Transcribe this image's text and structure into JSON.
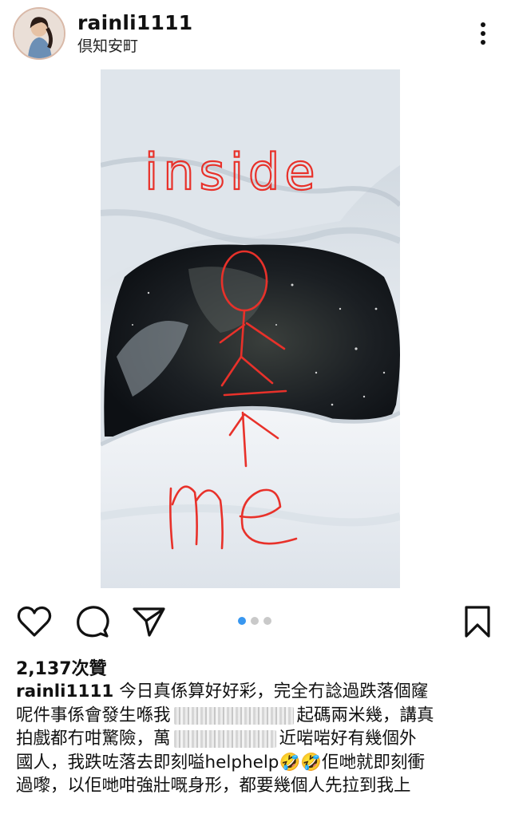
{
  "post": {
    "username": "rainli1111",
    "location": "倶知安町",
    "photo": {
      "drawn_text_top": "inside",
      "drawn_text_bottom": "me",
      "pager": {
        "current": 1,
        "total": 3
      }
    },
    "likes_text": "2,137次贊",
    "caption": {
      "username": "rainli1111",
      "lines": [
        "今日真係算好好彩，完全冇諗過跌落個窿",
        "呢件事係會發生喺我",
        "起碼兩米幾，講真",
        "拍戲都冇咁驚險，萬",
        "近啱啱好有幾個外",
        "國人，我跌咗落去即刻嗌helphelp",
        "🤣🤣佢哋就即刻衝",
        "過嚟，以佢哋咁強壯嘅身形，都要幾個人先拉到我上"
      ]
    },
    "accent_color": "#3897f0"
  }
}
